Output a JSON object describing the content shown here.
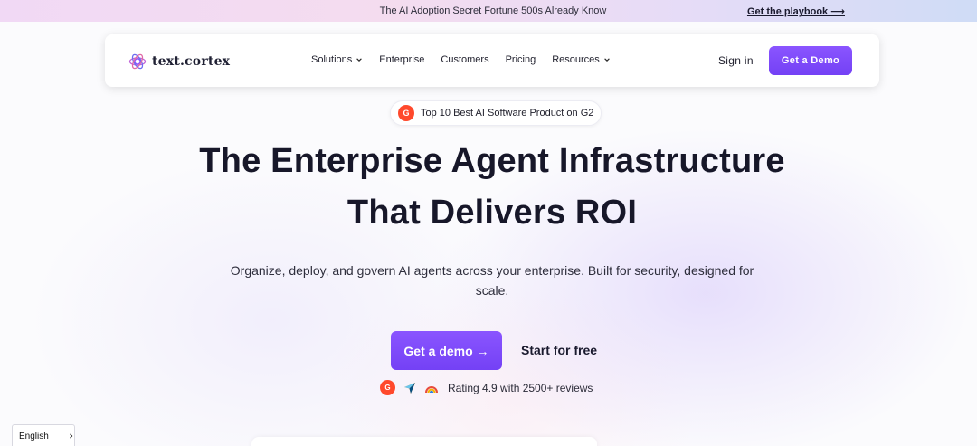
{
  "announcement": {
    "text": "The AI Adoption Secret Fortune 500s Already Know",
    "link": "Get the playbook ⟶"
  },
  "nav": {
    "logo_text": "text.cortex",
    "menu": [
      {
        "label": "Solutions",
        "has_dropdown": true
      },
      {
        "label": "Enterprise",
        "has_dropdown": false
      },
      {
        "label": "Customers",
        "has_dropdown": false
      },
      {
        "label": "Pricing",
        "has_dropdown": false
      },
      {
        "label": "Resources",
        "has_dropdown": true
      }
    ],
    "sign_in": "Sign in",
    "demo_button": "Get a Demo"
  },
  "badge": {
    "icon_text": "G",
    "text": "Top 10 Best AI Software Product on G2"
  },
  "hero": {
    "headline_line1": "The Enterprise Agent Infrastructure",
    "headline_line2": "That Delivers ROI",
    "subtitle": "Organize, deploy, and govern AI agents across your enterprise. Built for security, designed for scale.",
    "cta_primary": "Get a demo →",
    "cta_secondary": "Start for free",
    "rating_text": "Rating 4.9 with 2500+ reviews",
    "rating_icons": [
      "g2-icon",
      "capterra-icon",
      "getapp-icon"
    ]
  },
  "language": {
    "selected": "English"
  },
  "colors": {
    "accent": "#7c4dff",
    "g2_red": "#ff492c"
  }
}
